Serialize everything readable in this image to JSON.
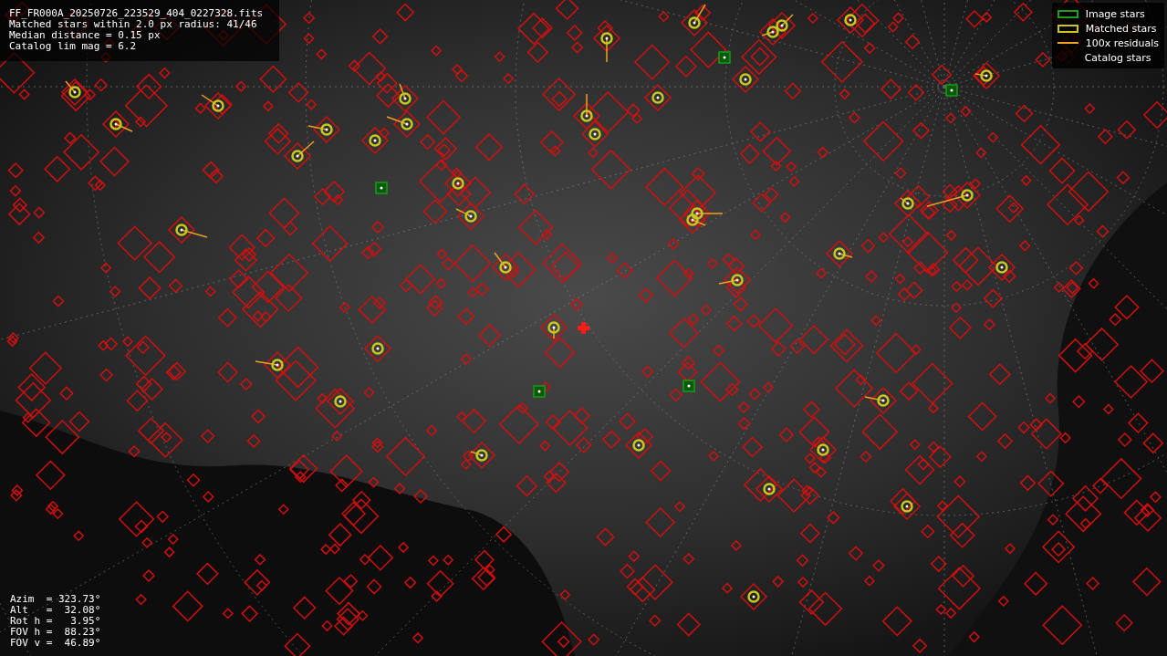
{
  "info_panel": {
    "lines": [
      "FF_FR000A_20250726_223529_404_0227328.fits",
      "Matched stars within 2.0 px radius: 41/46",
      "Median distance = 0.15 px",
      "Catalog lim mag = 6.2"
    ]
  },
  "legend": [
    {
      "kind": "image",
      "label": "Image stars"
    },
    {
      "kind": "matched",
      "label": "Matched stars"
    },
    {
      "kind": "residual",
      "label": "100x residuals"
    },
    {
      "kind": "catalog",
      "label": "Catalog stars"
    }
  ],
  "pointing_panel": {
    "lines": [
      "Azim  = 323.73°",
      "Alt   =  32.08°",
      "Rot h =   3.95°",
      "FOV h =  88.23°",
      "FOV v =  46.89°"
    ]
  }
}
